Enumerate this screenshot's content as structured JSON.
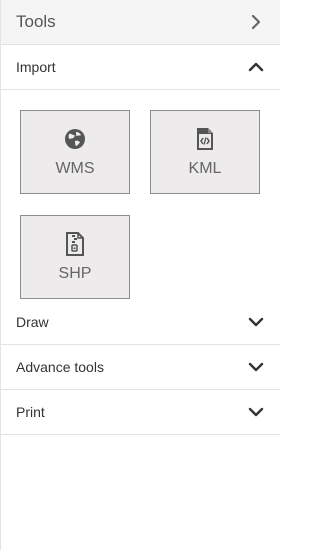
{
  "header": {
    "title": "Tools",
    "chevron_icon": "chevron-right-icon"
  },
  "sections": {
    "import": {
      "label": "Import",
      "expanded": true,
      "chevron_icon": "chevron-up-icon",
      "tools": [
        {
          "label": "WMS",
          "icon": "globe-icon"
        },
        {
          "label": "KML",
          "icon": "code-file-icon"
        },
        {
          "label": "SHP",
          "icon": "zip-file-icon"
        }
      ]
    },
    "draw": {
      "label": "Draw",
      "chevron_icon": "chevron-down-icon"
    },
    "advance_tools": {
      "label": "Advance tools",
      "chevron_icon": "chevron-down-icon"
    },
    "print": {
      "label": "Print",
      "chevron_icon": "chevron-down-icon"
    }
  },
  "colors": {
    "header_bg": "#f5f5f5",
    "tool_bg": "#edebeb",
    "tool_border": "#8e8e8e",
    "divider": "#e2e2e2",
    "icon": "#555555"
  }
}
